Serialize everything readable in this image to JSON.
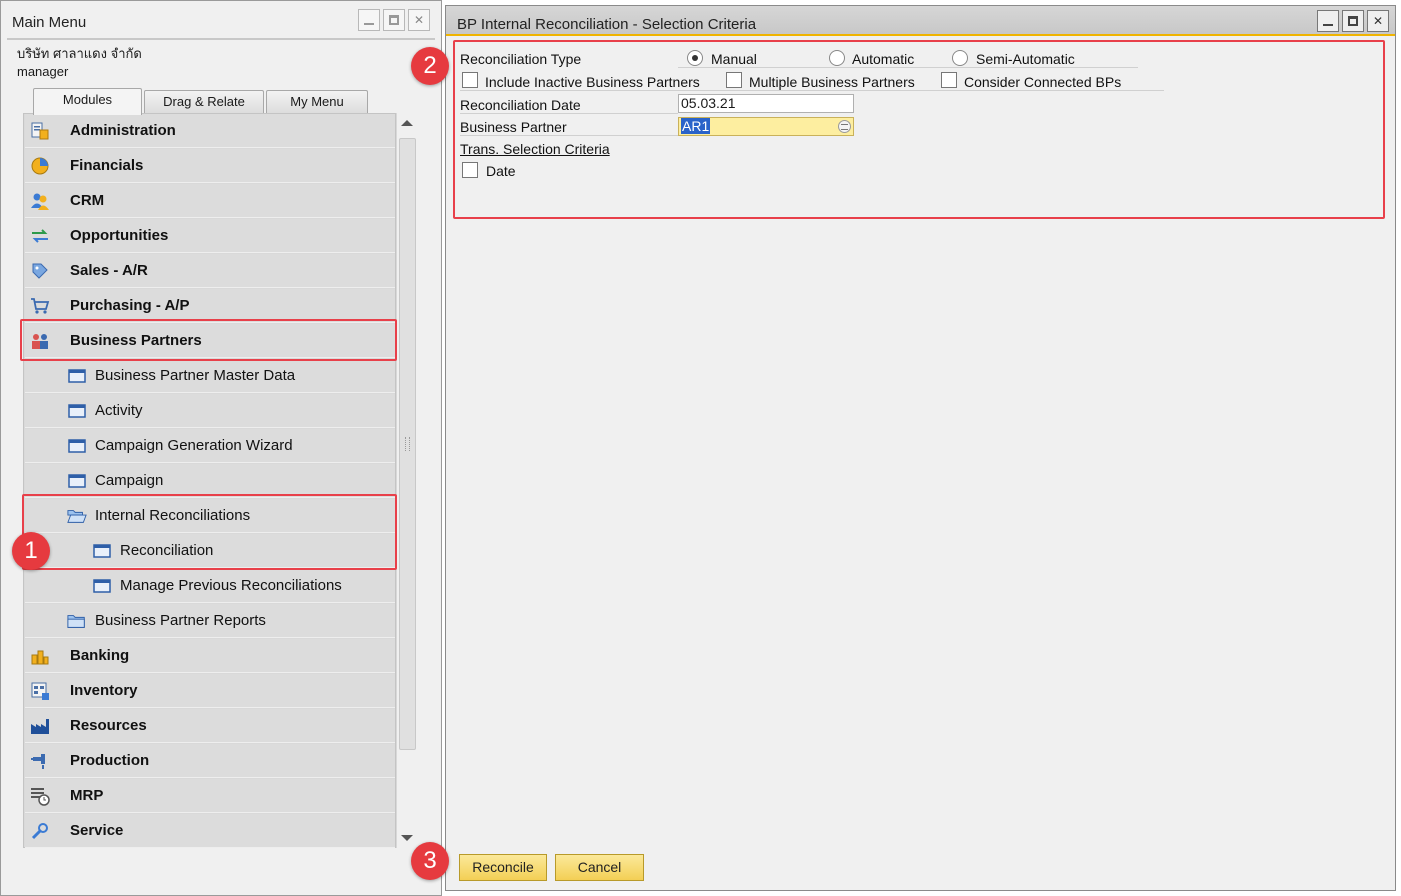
{
  "main_menu": {
    "title": "Main Menu",
    "company": "บริษัท ศาลาแดง จำกัด",
    "user": "manager",
    "tabs": [
      "Modules",
      "Drag & Relate",
      "My Menu"
    ],
    "items": [
      {
        "label": "Administration",
        "level": "module",
        "icon": "administration-icon"
      },
      {
        "label": "Financials",
        "level": "module",
        "icon": "financials-icon"
      },
      {
        "label": "CRM",
        "level": "module",
        "icon": "crm-icon"
      },
      {
        "label": "Opportunities",
        "level": "module",
        "icon": "opportunities-icon"
      },
      {
        "label": "Sales - A/R",
        "level": "module",
        "icon": "sales-icon"
      },
      {
        "label": "Purchasing - A/P",
        "level": "module",
        "icon": "purchasing-icon"
      },
      {
        "label": "Business Partners",
        "level": "module",
        "icon": "business-partners-icon"
      },
      {
        "label": "Business Partner Master Data",
        "level": "form",
        "icon": "form-icon"
      },
      {
        "label": "Activity",
        "level": "form",
        "icon": "form-icon"
      },
      {
        "label": "Campaign Generation Wizard",
        "level": "form",
        "icon": "form-icon"
      },
      {
        "label": "Campaign",
        "level": "form",
        "icon": "form-icon"
      },
      {
        "label": "Internal Reconciliations",
        "level": "folder-open",
        "icon": "folder-open-icon"
      },
      {
        "label": "Reconciliation",
        "level": "subform",
        "icon": "form-icon"
      },
      {
        "label": "Manage Previous Reconciliations",
        "level": "subform",
        "icon": "form-icon"
      },
      {
        "label": "Business Partner Reports",
        "level": "folder",
        "icon": "folder-icon"
      },
      {
        "label": "Banking",
        "level": "module",
        "icon": "banking-icon"
      },
      {
        "label": "Inventory",
        "level": "module",
        "icon": "inventory-icon"
      },
      {
        "label": "Resources",
        "level": "module",
        "icon": "resources-icon"
      },
      {
        "label": "Production",
        "level": "module",
        "icon": "production-icon"
      },
      {
        "label": "MRP",
        "level": "module",
        "icon": "mrp-icon"
      },
      {
        "label": "Service",
        "level": "module",
        "icon": "service-icon"
      }
    ]
  },
  "reconciliation_window": {
    "title": "BP Internal Reconciliation - Selection Criteria",
    "reconciliation_type_label": "Reconciliation Type",
    "radio_options": [
      "Manual",
      "Automatic",
      "Semi-Automatic"
    ],
    "selected_type": "Manual",
    "checkboxes": [
      "Include Inactive Business Partners",
      "Multiple Business Partners",
      "Consider Connected BPs"
    ],
    "reconciliation_date_label": "Reconciliation Date",
    "reconciliation_date_value": "05.03.21",
    "business_partner_label": "Business Partner",
    "business_partner_value": "AR1",
    "trans_selection_label": "Trans. Selection Criteria",
    "date_checkbox_label": "Date",
    "reconcile_button": "Reconcile",
    "cancel_button": "Cancel"
  },
  "annotations": {
    "badge_1": "1",
    "badge_2": "2",
    "badge_3": "3",
    "badge_color": "#e63a3f"
  }
}
